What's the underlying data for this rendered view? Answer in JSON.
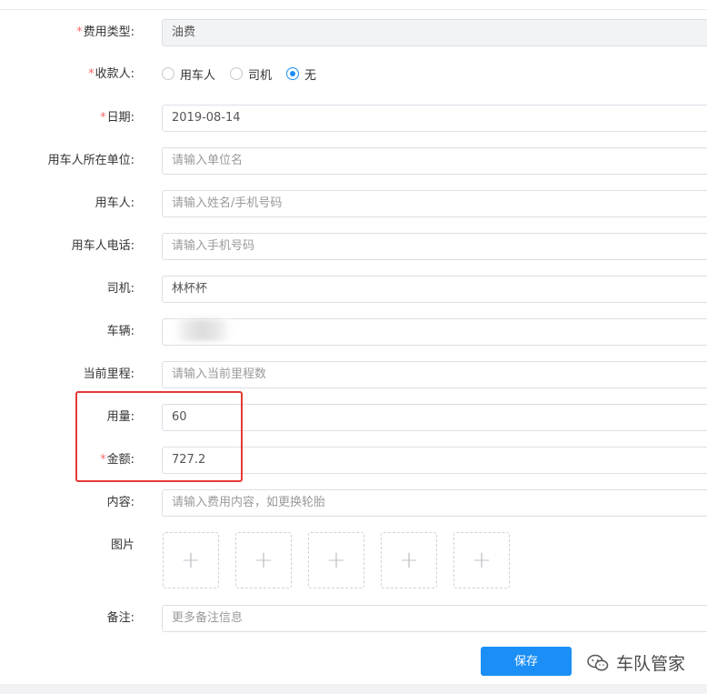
{
  "form": {
    "expense_type": {
      "label": "费用类型:",
      "value": "油费"
    },
    "payee": {
      "label": "收款人:",
      "options": [
        "用车人",
        "司机",
        "无"
      ],
      "selected": "无"
    },
    "date": {
      "label": "日期:",
      "value": "2019-08-14"
    },
    "org": {
      "label": "用车人所在单位:",
      "placeholder": "请输入单位名"
    },
    "user": {
      "label": "用车人:",
      "placeholder": "请输入姓名/手机号码"
    },
    "phone": {
      "label": "用车人电话:",
      "placeholder": "请输入手机号码"
    },
    "driver": {
      "label": "司机:",
      "value": "林杯杯"
    },
    "vehicle": {
      "label": "车辆:",
      "value": ""
    },
    "mileage": {
      "label": "当前里程:",
      "placeholder": "请输入当前里程数"
    },
    "quantity": {
      "label": "用量:",
      "value": "60"
    },
    "amount": {
      "label": "金额:",
      "value": "727.2"
    },
    "content": {
      "label": "内容:",
      "placeholder": "请输入费用内容，如更换轮胎"
    },
    "images": {
      "label": "图片",
      "slots": [
        "+",
        "+",
        "+",
        "+",
        "+"
      ]
    },
    "remark": {
      "label": "备注:",
      "placeholder": "更多备注信息"
    },
    "required_mark": "*"
  },
  "actions": {
    "save_label": "保存"
  },
  "watermark": {
    "text": "车队管家"
  },
  "colors": {
    "accent": "#1b8ff5",
    "required": "#f56c6c",
    "highlight": "#e53935"
  }
}
